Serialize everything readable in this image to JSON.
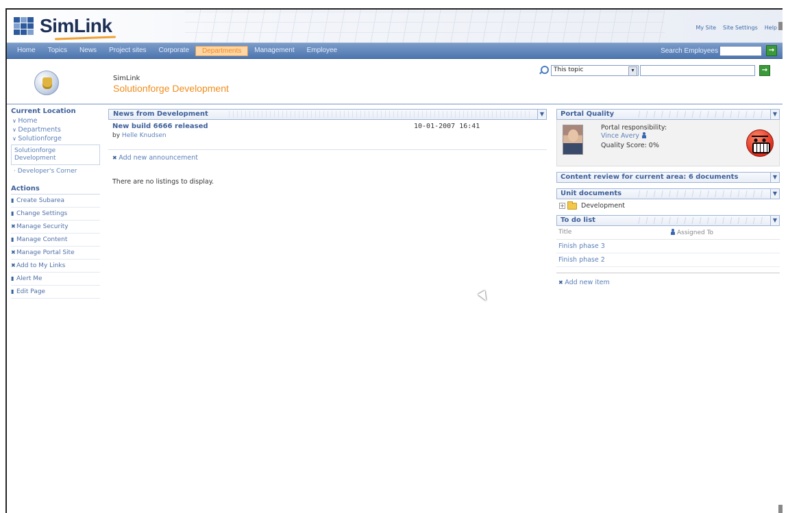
{
  "header": {
    "logo_text": "SimLink",
    "top_links": [
      "My Site",
      "Site Settings",
      "Help"
    ]
  },
  "nav": {
    "tabs": [
      "Home",
      "Topics",
      "News",
      "Project sites",
      "Corporate",
      "Departments",
      "Management",
      "Employee"
    ],
    "active_tab": "Departments",
    "search_label": "Search Employees",
    "search_value": "",
    "go_label": "→"
  },
  "title_area": {
    "site": "SimLink",
    "page_title": "Solutionforge Development",
    "topic_select": "This topic",
    "topic_input": ""
  },
  "left_nav": {
    "current_location_heading": "Current Location",
    "breadcrumbs": [
      "Home",
      "Departments",
      "Solutionforge"
    ],
    "current": "Solutionforge Development",
    "sub_link": "Developer's Corner",
    "actions_heading": "Actions",
    "actions": [
      "Create Subarea",
      "Change Settings",
      "Manage Security",
      "Manage Content",
      "Manage Portal Site",
      "Add to My Links",
      "Alert Me",
      "Edit Page"
    ]
  },
  "news": {
    "title": "News from Development",
    "item_title": "New build 6666 released",
    "item_by_prefix": "by",
    "item_author": "Helle Knudsen",
    "item_date": "10-01-2007 16:41",
    "add_announcement": "Add new announcement",
    "no_listings": "There are no listings to display."
  },
  "portal_quality": {
    "title": "Portal Quality",
    "responsibility_label": "Portal responsibility:",
    "person": "Vince Avery",
    "score_label": "Quality Score: 0%"
  },
  "content_review": {
    "title": "Content review for current area: 6 documents"
  },
  "unit_documents": {
    "title": "Unit documents",
    "folder": "Development"
  },
  "todo": {
    "title": "To do list",
    "col_title": "Title",
    "col_assigned": "Assigned To",
    "items": [
      "Finish phase 3",
      "Finish phase 2"
    ],
    "add_item": "Add new item"
  },
  "colors": {
    "accent_orange": "#f08c1c",
    "nav_blue": "#4d76b0",
    "link_blue": "#5a7fb8"
  }
}
